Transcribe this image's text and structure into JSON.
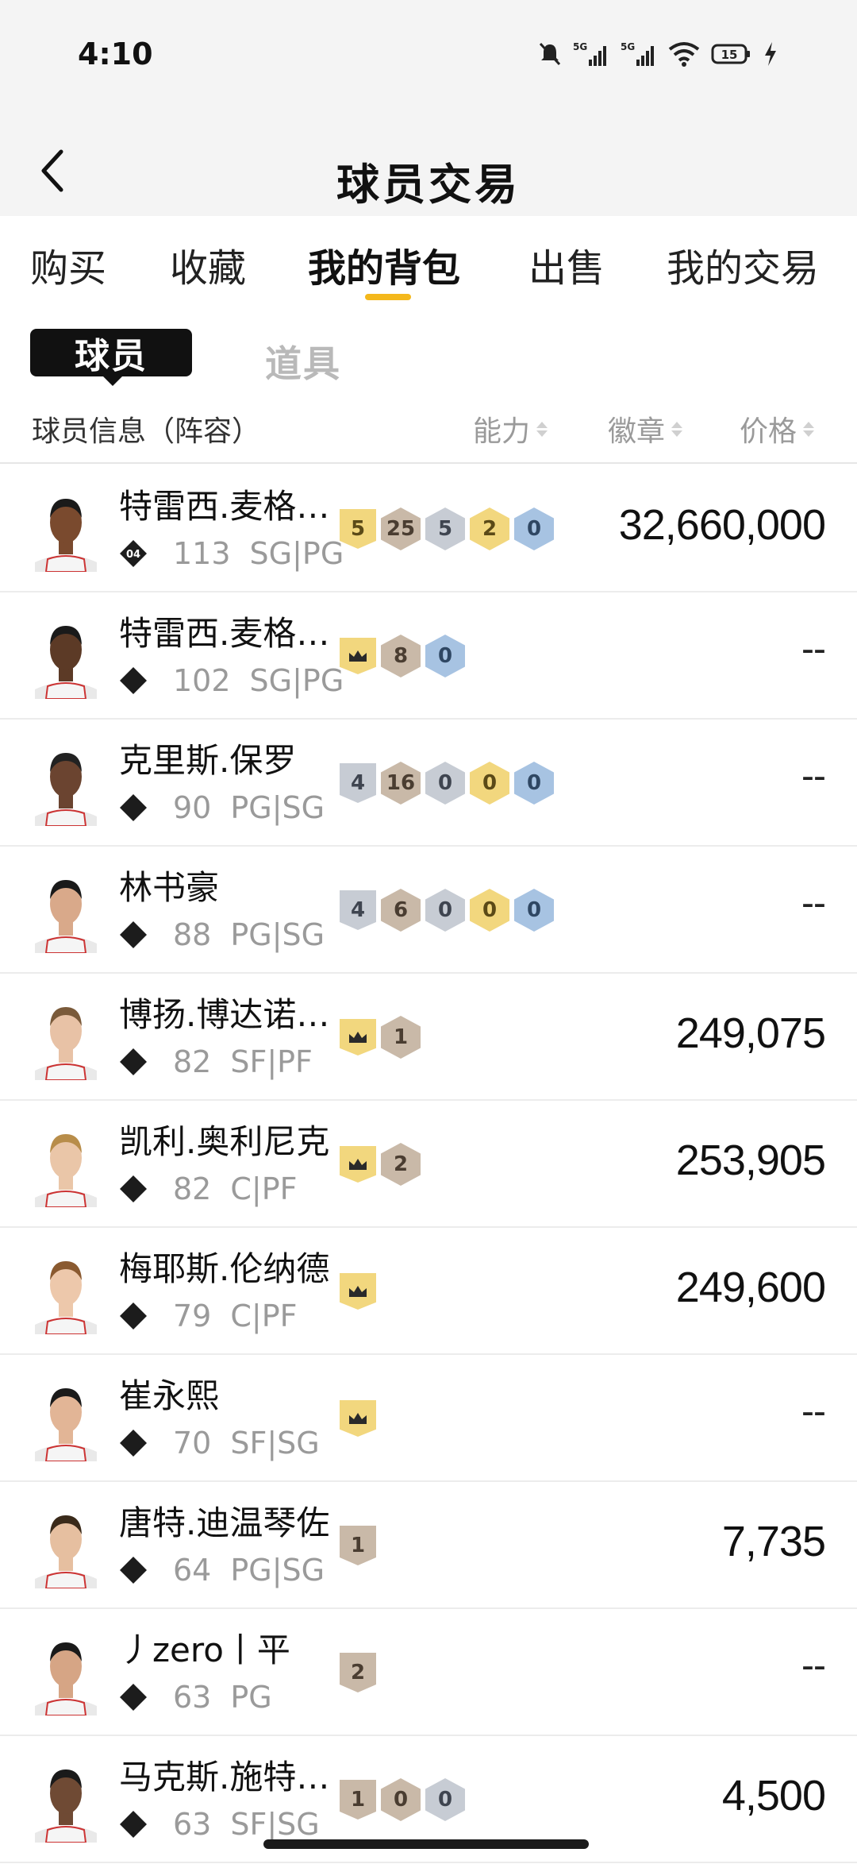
{
  "status_bar": {
    "time": "4:10",
    "icons": [
      "mute-icon",
      "signal-5g-icon",
      "signal-5g-icon",
      "wifi-icon",
      "battery-icon",
      "charging-icon"
    ],
    "net1": "5G",
    "net2": "5G",
    "battery": "15"
  },
  "nav": {
    "title": "球员交易"
  },
  "tabs": [
    {
      "label": "购买",
      "active": false
    },
    {
      "label": "收藏",
      "active": false
    },
    {
      "label": "我的背包",
      "active": true
    },
    {
      "label": "出售",
      "active": false
    },
    {
      "label": "我的交易",
      "active": false
    }
  ],
  "subtabs": {
    "active": "球员",
    "other": "道具"
  },
  "list_header": {
    "info": "球员信息（阵容）",
    "ability": "能力",
    "badge": "徽章",
    "price": "价格"
  },
  "colors": {
    "accent": "#f4b81c",
    "gold": "#f2d77e",
    "bronze": "#c8b9a9",
    "silver": "#c6ccd4",
    "blue": "#a9c4e2"
  },
  "players": [
    {
      "name": "特雷西.麦格…",
      "rating": "113",
      "pos": "SG|PG",
      "rank": "04",
      "price": "32,660,000",
      "badges": [
        {
          "t": "level",
          "v": "5",
          "c": "gold"
        },
        {
          "t": "hex",
          "v": "25",
          "c": "bronze"
        },
        {
          "t": "hex",
          "v": "5",
          "c": "silver"
        },
        {
          "t": "hex",
          "v": "2",
          "c": "gold"
        },
        {
          "t": "hex",
          "v": "0",
          "c": "blue"
        }
      ]
    },
    {
      "name": "特雷西.麦格…",
      "rating": "102",
      "pos": "SG|PG",
      "rank": "",
      "price": "--",
      "badges": [
        {
          "t": "crown",
          "v": "",
          "c": "gold"
        },
        {
          "t": "hex",
          "v": "8",
          "c": "bronze"
        },
        {
          "t": "hex",
          "v": "0",
          "c": "blue"
        }
      ]
    },
    {
      "name": "克里斯.保罗",
      "rating": "90",
      "pos": "PG|SG",
      "rank": "",
      "price": "--",
      "badges": [
        {
          "t": "level",
          "v": "4",
          "c": "silver"
        },
        {
          "t": "hex",
          "v": "16",
          "c": "bronze"
        },
        {
          "t": "hex",
          "v": "0",
          "c": "silver"
        },
        {
          "t": "hex",
          "v": "0",
          "c": "gold"
        },
        {
          "t": "hex",
          "v": "0",
          "c": "blue"
        }
      ]
    },
    {
      "name": "林书豪",
      "rating": "88",
      "pos": "PG|SG",
      "rank": "",
      "price": "--",
      "badges": [
        {
          "t": "level",
          "v": "4",
          "c": "silver"
        },
        {
          "t": "hex",
          "v": "6",
          "c": "bronze"
        },
        {
          "t": "hex",
          "v": "0",
          "c": "silver"
        },
        {
          "t": "hex",
          "v": "0",
          "c": "gold"
        },
        {
          "t": "hex",
          "v": "0",
          "c": "blue"
        }
      ]
    },
    {
      "name": "博扬.博达诺…",
      "rating": "82",
      "pos": "SF|PF",
      "rank": "",
      "price": "249,075",
      "badges": [
        {
          "t": "crown",
          "v": "",
          "c": "gold"
        },
        {
          "t": "hex",
          "v": "1",
          "c": "bronze"
        }
      ]
    },
    {
      "name": "凯利.奥利尼克",
      "rating": "82",
      "pos": "C|PF",
      "rank": "",
      "price": "253,905",
      "badges": [
        {
          "t": "crown",
          "v": "",
          "c": "gold"
        },
        {
          "t": "hex",
          "v": "2",
          "c": "bronze"
        }
      ]
    },
    {
      "name": "梅耶斯.伦纳德",
      "rating": "79",
      "pos": "C|PF",
      "rank": "",
      "price": "249,600",
      "badges": [
        {
          "t": "crown",
          "v": "",
          "c": "gold"
        }
      ]
    },
    {
      "name": "崔永熙",
      "rating": "70",
      "pos": "SF|SG",
      "rank": "",
      "price": "--",
      "badges": [
        {
          "t": "crown",
          "v": "",
          "c": "gold"
        }
      ]
    },
    {
      "name": "唐特.迪温琴佐",
      "rating": "64",
      "pos": "PG|SG",
      "rank": "",
      "price": "7,735",
      "badges": [
        {
          "t": "level",
          "v": "1",
          "c": "bronze"
        }
      ]
    },
    {
      "name": "丿zero丨平",
      "rating": "63",
      "pos": "PG",
      "rank": "",
      "price": "--",
      "badges": [
        {
          "t": "level",
          "v": "2",
          "c": "bronze"
        }
      ]
    },
    {
      "name": "马克斯.施特…",
      "rating": "63",
      "pos": "SF|SG",
      "rank": "",
      "price": "4,500",
      "badges": [
        {
          "t": "level",
          "v": "1",
          "c": "bronze"
        },
        {
          "t": "hex",
          "v": "0",
          "c": "bronze"
        },
        {
          "t": "hex",
          "v": "0",
          "c": "silver"
        }
      ]
    }
  ]
}
